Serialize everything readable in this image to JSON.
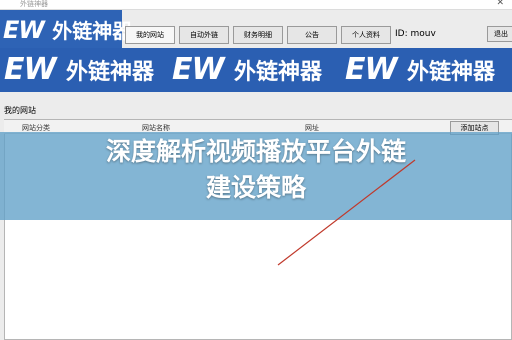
{
  "window": {
    "title": "外链神器"
  },
  "logo": {
    "mark": "EW",
    "text": "外链神器"
  },
  "tabs": [
    "我的网站",
    "自动外链",
    "财务明细",
    "公告",
    "个人资料"
  ],
  "user": {
    "id_label": "ID: mouv"
  },
  "exit_label": "退出",
  "banner": {
    "mark": "EW",
    "text": "外链神器"
  },
  "section": {
    "title": "我的网站"
  },
  "table": {
    "columns": [
      "网站分类",
      "网站名称",
      "网址"
    ],
    "add_button": "添加站点"
  },
  "headline": {
    "line1": "深度解析视频播放平台外链",
    "line2": "建设策略"
  },
  "colors": {
    "brand_blue": "#2e63b5",
    "overlay": "#60a0c8",
    "stroke": "#c0392b"
  }
}
